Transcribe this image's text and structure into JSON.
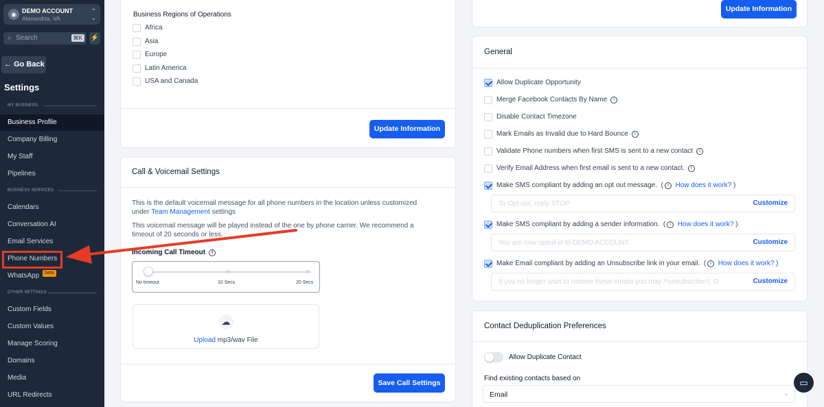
{
  "sidebar": {
    "account_name": "DEMO ACCOUNT",
    "account_location": "Alexandria, VA",
    "search_placeholder": "Search",
    "search_shortcut": "⌘K",
    "go_back": "Go Back",
    "settings_title": "Settings",
    "sections": {
      "my_business": "MY BUSINESS",
      "business_services": "BUSINESS SERVICES",
      "other_settings": "OTHER SETTINGS"
    },
    "items": {
      "business_profile": "Business Profile",
      "company_billing": "Company Billing",
      "my_staff": "My Staff",
      "pipelines": "Pipelines",
      "calendars": "Calendars",
      "conversation_ai": "Conversation AI",
      "email_services": "Email Services",
      "phone_numbers": "Phone Numbers",
      "whatsapp": "WhatsApp",
      "whatsapp_badge": "beta",
      "custom_fields": "Custom Fields",
      "custom_values": "Custom Values",
      "manage_scoring": "Manage Scoring",
      "domains": "Domains",
      "media": "Media",
      "url_redirects": "URL Redirects"
    },
    "active_item": "Business Profile"
  },
  "regions": {
    "title": "Business Regions of Operations",
    "options": [
      "Africa",
      "Asia",
      "Europe",
      "Latin America",
      "USA and Canada"
    ],
    "update_button": "Update Information"
  },
  "voicemail": {
    "title": "Call & Voicemail Settings",
    "desc1_prefix": "This is the default voicemail message for all phone numbers in the location unless customized under",
    "desc1_link": "Team Management",
    "desc1_suffix": "settings",
    "desc2": "This voicemail message will be played instead of the one by phone carrier. We recommend a timeout of 20 seconds or less.",
    "timeout_label": "Incoming Call Timeout",
    "slider_labels": [
      "No timeout",
      "10 Secs",
      "20 Secs"
    ],
    "slider_value": 0,
    "upload_link": "Upload",
    "upload_text": "mp3/wav File",
    "save_button": "Save Call Settings"
  },
  "right_top": {
    "update_button": "Update Information"
  },
  "general": {
    "title": "General",
    "options": [
      {
        "label": "Allow Duplicate Opportunity",
        "checked": true,
        "info": false
      },
      {
        "label": "Merge Facebook Contacts By Name",
        "checked": false,
        "info": true
      },
      {
        "label": "Disable Contact Timezone",
        "checked": false,
        "info": false
      },
      {
        "label": "Mark Emails as Invalid due to Hard Bounce",
        "checked": false,
        "info": true
      },
      {
        "label": "Validate Phone numbers when first SMS is sent to a new contact",
        "checked": false,
        "info": true
      },
      {
        "label": "Verify Email Address when first email is sent to a new contact.",
        "checked": false,
        "info": true
      }
    ],
    "compliance": [
      {
        "label": "Make SMS compliant by adding an opt out message.",
        "checked": true,
        "link": "How does it work?",
        "placeholder": "To Opt-out, reply STOP",
        "button": "Customize"
      },
      {
        "label": "Make SMS compliant by adding a sender information.",
        "checked": true,
        "link": "How does it work?",
        "placeholder": "You are now opted-in to DEMO ACCOUNT",
        "button": "Customize"
      },
      {
        "label": "Make Email compliant by adding an Unsubscribe link in your email.",
        "checked": true,
        "link": "How does it work?",
        "placeholder": "If you no longer wish to receive these emails you may /*unsubscribe*/, D",
        "button": "Customize"
      }
    ]
  },
  "dedup": {
    "title": "Contact Deduplication Preferences",
    "toggle_label": "Allow Duplicate Contact",
    "toggle_on": false,
    "find_label": "Find existing contacts based on",
    "select_value": "Email"
  },
  "colors": {
    "sidebar_bg": "#1d2939",
    "primary": "#155eef",
    "annotation_red": "#e63b25"
  }
}
